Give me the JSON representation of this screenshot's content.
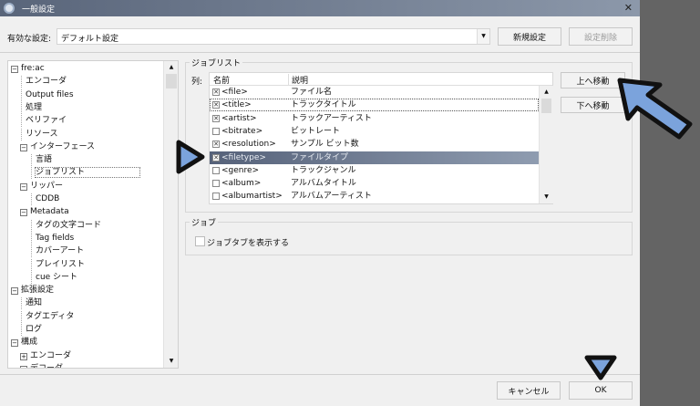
{
  "window": {
    "title": "一般設定",
    "close": "✕"
  },
  "config": {
    "label": "有効な設定:",
    "value": "デフォルト設定",
    "new_button": "新規設定",
    "delete_button": "設定削除"
  },
  "tree": [
    {
      "label": "fre:ac",
      "level": 0,
      "box": "⊟"
    },
    {
      "label": "エンコーダ",
      "level": 1
    },
    {
      "label": "Output files",
      "level": 1
    },
    {
      "label": "処理",
      "level": 1
    },
    {
      "label": "ベリファイ",
      "level": 1
    },
    {
      "label": "リソース",
      "level": 1
    },
    {
      "label": "インターフェース",
      "level": 1,
      "box": "⊟"
    },
    {
      "label": "言語",
      "level": 2
    },
    {
      "label": "ジョブリスト",
      "level": 2,
      "selected": true
    },
    {
      "label": "リッパー",
      "level": 1,
      "box": "⊟"
    },
    {
      "label": "CDDB",
      "level": 2
    },
    {
      "label": "Metadata",
      "level": 1,
      "box": "⊟"
    },
    {
      "label": "タグの文字コード",
      "level": 2
    },
    {
      "label": "Tag fields",
      "level": 2
    },
    {
      "label": "カバーアート",
      "level": 2
    },
    {
      "label": "プレイリスト",
      "level": 2
    },
    {
      "label": "cue シート",
      "level": 2
    },
    {
      "label": "拡張設定",
      "level": 0,
      "box": "⊟"
    },
    {
      "label": "通知",
      "level": 1
    },
    {
      "label": "タグエディタ",
      "level": 1
    },
    {
      "label": "ログ",
      "level": 1
    },
    {
      "label": "構成",
      "level": 0,
      "box": "⊟"
    },
    {
      "label": "エンコーダ",
      "level": 1,
      "box": "⊞"
    },
    {
      "label": "デコーダ",
      "level": 1,
      "box": "⊟"
    }
  ],
  "joblist": {
    "group_label": "ジョブリスト",
    "columns_label": "列:",
    "headers": [
      "名前",
      "説明"
    ],
    "rows": [
      {
        "name": "<file>",
        "desc": "ファイル名",
        "checked": true
      },
      {
        "name": "<title>",
        "desc": "トラックタイトル",
        "checked": true,
        "focused": true
      },
      {
        "name": "<artist>",
        "desc": "トラックアーティスト",
        "checked": true
      },
      {
        "name": "<bitrate>",
        "desc": "ビットレート",
        "checked": false
      },
      {
        "name": "<resolution>",
        "desc": "サンプル ビット数",
        "checked": true
      },
      {
        "name": "<filetype>",
        "desc": "ファイルタイプ",
        "checked": true,
        "selected": true
      },
      {
        "name": "<genre>",
        "desc": "トラックジャンル",
        "checked": false
      },
      {
        "name": "<album>",
        "desc": "アルバムタイトル",
        "checked": false
      },
      {
        "name": "<albumartist>",
        "desc": "アルバムアーティスト",
        "checked": false
      }
    ],
    "move_up": "上へ移動",
    "move_down": "下へ移動"
  },
  "job": {
    "group_label": "ジョブ",
    "show_tab_label": "ジョブタブを表示する",
    "show_tab_checked": false
  },
  "footer": {
    "cancel": "キャンセル",
    "ok": "OK"
  },
  "colors": {
    "annotation": "#7ba3dc",
    "selection": "#56627a"
  }
}
